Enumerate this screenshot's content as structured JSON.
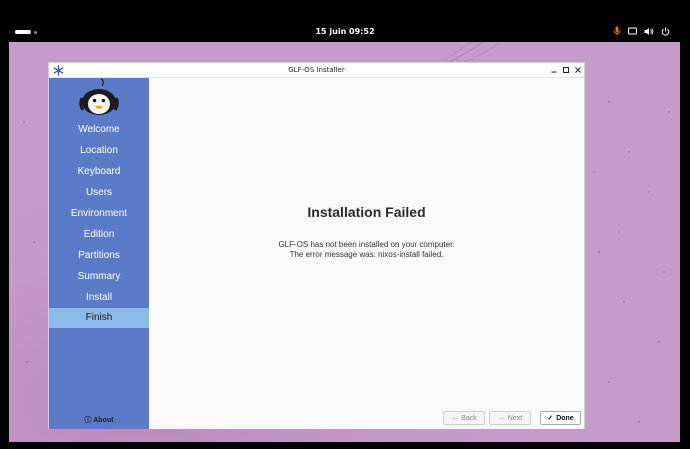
{
  "topbar": {
    "clock": "15 juin  09:52",
    "icons": [
      "mic-icon",
      "screen-icon",
      "volume-icon",
      "power-icon"
    ],
    "accent_mic": "#e07020"
  },
  "window": {
    "title": "GLF-OS Installer",
    "controls": [
      "minimize-icon",
      "maximize-icon",
      "close-icon"
    ]
  },
  "sidebar": {
    "bg_color": "#5b7bc9",
    "active_color": "#8cbbe9",
    "items": [
      {
        "label": "Welcome"
      },
      {
        "label": "Location"
      },
      {
        "label": "Keyboard"
      },
      {
        "label": "Users"
      },
      {
        "label": "Environment"
      },
      {
        "label": "Edition"
      },
      {
        "label": "Partitions"
      },
      {
        "label": "Summary"
      },
      {
        "label": "Install"
      },
      {
        "label": "Finish"
      }
    ],
    "active_index": 9,
    "about_label": "About"
  },
  "main": {
    "heading": "Installation Failed",
    "line1": "GLF-OS has not been installed on your computer.",
    "line2": "The error message was: nixos-install failed."
  },
  "buttons": {
    "back": "Back",
    "next": "Next",
    "done": "Done"
  }
}
